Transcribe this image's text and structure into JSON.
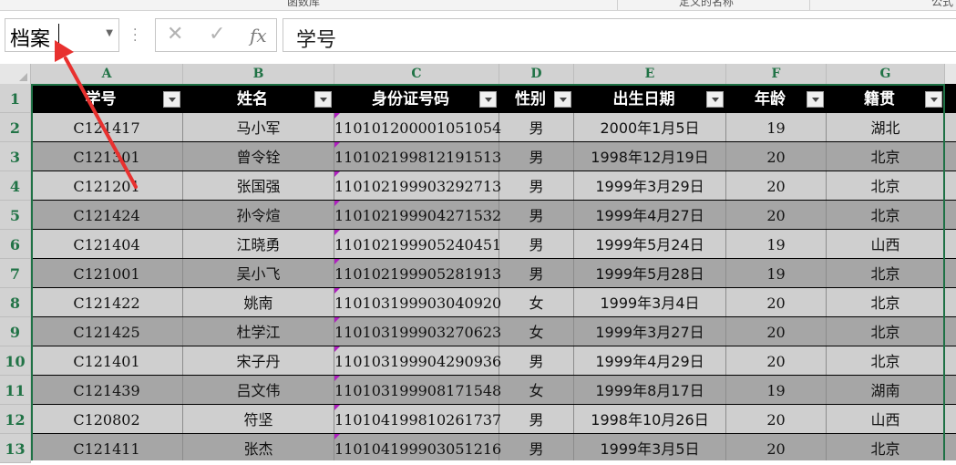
{
  "ribbon": {
    "groups": [
      "函数库",
      "定义的名称",
      "公式"
    ]
  },
  "name_box": {
    "value": "档案"
  },
  "formula_bar": {
    "cancel_icon": "✕",
    "enter_icon": "✓",
    "fx_label": "fx",
    "value": "学号"
  },
  "columns": [
    "A",
    "B",
    "C",
    "D",
    "E",
    "F",
    "G"
  ],
  "rows": [
    "1",
    "2",
    "3",
    "4",
    "5",
    "6",
    "7",
    "8",
    "9",
    "10",
    "11",
    "12",
    "13"
  ],
  "table": {
    "headers": [
      "学号",
      "姓名",
      "身份证号码",
      "性别",
      "出生日期",
      "年龄",
      "籍贯"
    ],
    "rows": [
      [
        "C121417",
        "马小军",
        "110101200001051054",
        "男",
        "2000年1月5日",
        "19",
        "湖北"
      ],
      [
        "C121301",
        "曾令铨",
        "110102199812191513",
        "男",
        "1998年12月19日",
        "20",
        "北京"
      ],
      [
        "C121201",
        "张国强",
        "110102199903292713",
        "男",
        "1999年3月29日",
        "20",
        "北京"
      ],
      [
        "C121424",
        "孙令煊",
        "110102199904271532",
        "男",
        "1999年4月27日",
        "20",
        "北京"
      ],
      [
        "C121404",
        "江晓勇",
        "110102199905240451",
        "男",
        "1999年5月24日",
        "19",
        "山西"
      ],
      [
        "C121001",
        "吴小飞",
        "110102199905281913",
        "男",
        "1999年5月28日",
        "19",
        "北京"
      ],
      [
        "C121422",
        "姚南",
        "110103199903040920",
        "女",
        "1999年3月4日",
        "20",
        "北京"
      ],
      [
        "C121425",
        "杜学江",
        "110103199903270623",
        "女",
        "1999年3月27日",
        "20",
        "北京"
      ],
      [
        "C121401",
        "宋子丹",
        "110103199904290936",
        "男",
        "1999年4月29日",
        "20",
        "北京"
      ],
      [
        "C121439",
        "吕文伟",
        "110103199908171548",
        "女",
        "1999年8月17日",
        "19",
        "湖南"
      ],
      [
        "C120802",
        "符坚",
        "110104199810261737",
        "男",
        "1998年10月26日",
        "20",
        "山西"
      ],
      [
        "C121411",
        "张杰",
        "110104199903051216",
        "男",
        "1999年3月5日",
        "20",
        "北京"
      ]
    ]
  },
  "annotation": {
    "arrow_color": "#e8312f"
  },
  "colors": {
    "header_fill": "#000000",
    "band_dark": "#a6a6a6",
    "band_light": "#cfcfcf",
    "grid_header_text": "#217346",
    "table_border": "#1e7145"
  }
}
